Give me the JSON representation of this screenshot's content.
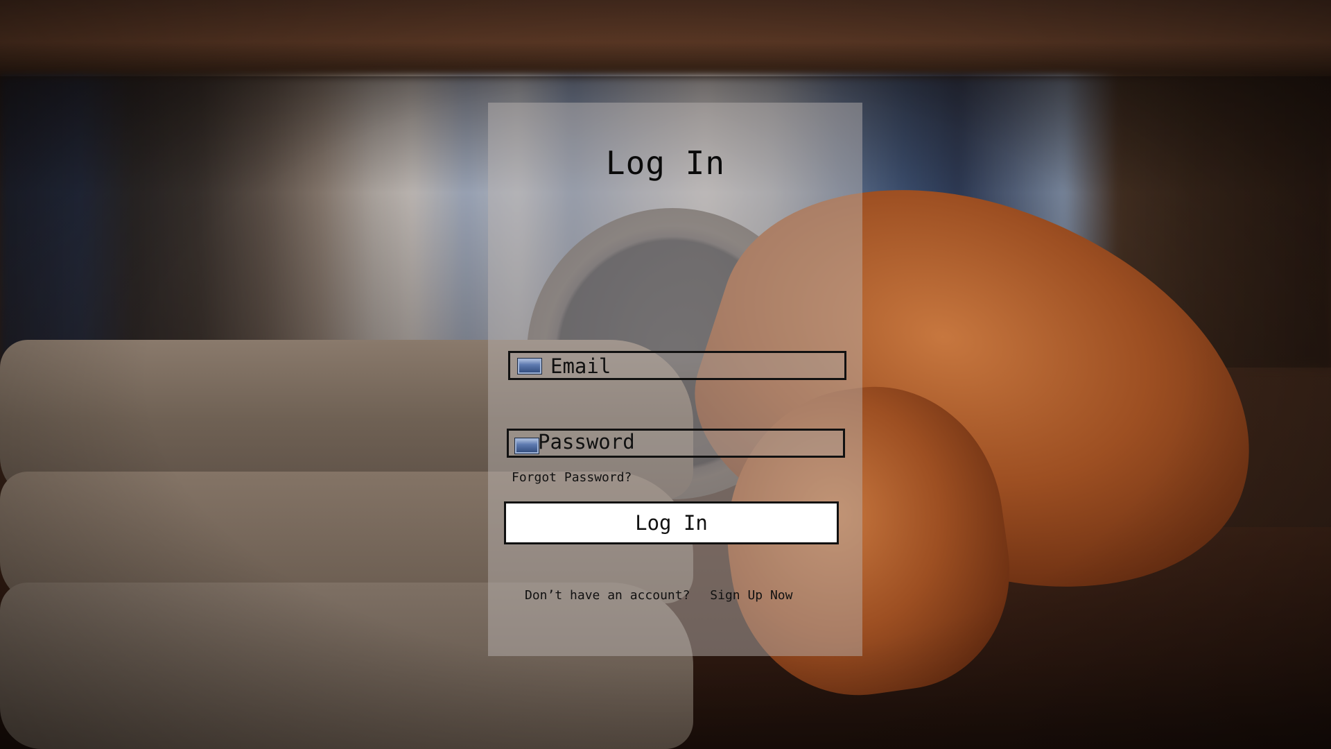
{
  "login": {
    "title": "Log In",
    "email_placeholder": "Email",
    "password_placeholder": "Password",
    "forgot_label": "Forgot Password?",
    "submit_label": "Log In",
    "no_account_text": "Don’t have an account?",
    "signup_label": "Sign Up Now"
  },
  "icons": {
    "email": "email-field-icon",
    "password": "password-field-icon"
  }
}
